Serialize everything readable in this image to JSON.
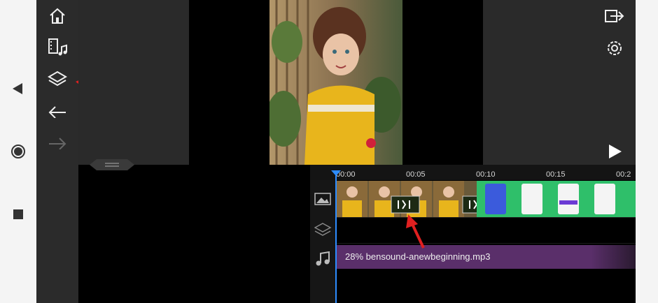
{
  "colors": {
    "accent_red": "#e02020",
    "playhead_blue": "#2d8cff",
    "audio_purple": "#5a2f6a",
    "clip_green": "#1e7f4a"
  },
  "nav": {
    "icons": [
      "back-triangle-icon",
      "home-circle-icon",
      "recents-square-icon"
    ]
  },
  "toolbar": {
    "icons": [
      "home-icon",
      "media-icon",
      "layers-icon",
      "undo-icon",
      "redo-icon"
    ]
  },
  "right_tools": {
    "icons": [
      "export-icon",
      "settings-icon",
      "play-icon"
    ]
  },
  "timeline": {
    "ticks": [
      "00:00",
      "00:05",
      "00:10",
      "00:15",
      "00:2"
    ],
    "audio_label": "28% bensound-anewbeginning.mp3",
    "track_icons": [
      "image-track-icon",
      "layer-track-icon",
      "audio-track-icon"
    ]
  }
}
